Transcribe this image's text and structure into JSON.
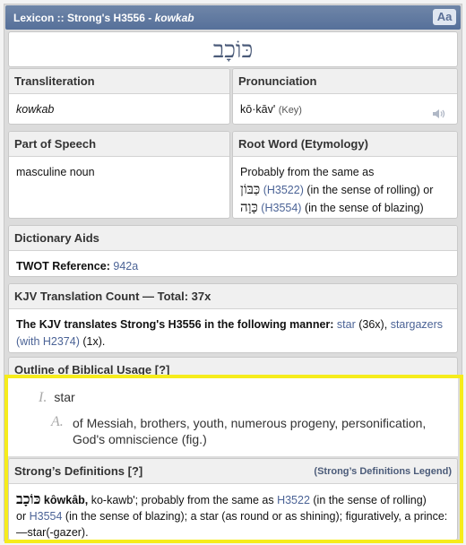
{
  "titlebar": {
    "prefix": "Lexicon :: Strong's H3556 - ",
    "word": "kowkab",
    "font_button": "Aa"
  },
  "headword": "כּוֹכָב",
  "transliteration": {
    "heading": "Transliteration",
    "value": "kowkab"
  },
  "pronunciation": {
    "heading": "Pronunciation",
    "value": "kō·kāv'",
    "key": "(Key)",
    "icon": "speaker-icon"
  },
  "part_of_speech": {
    "heading": "Part of Speech",
    "value": "masculine noun"
  },
  "root_word": {
    "heading": "Root Word (Etymology)",
    "intro": "Probably from the same as",
    "ref1_hebrew": "כַּבּוֹן",
    "ref1_code": "(H3522)",
    "ref1_sense": " (in the sense of rolling) or",
    "ref2_hebrew": "כָּוָה",
    "ref2_code": "(H3554)",
    "ref2_sense": " (in the sense of blazing)"
  },
  "dictionary_aids": {
    "heading": "Dictionary Aids",
    "label": "TWOT Reference:",
    "value": "942a"
  },
  "kjv_count": {
    "heading": "KJV Translation Count — Total: 37x",
    "lead": "The KJV translates Strong's H3556 in the following manner:",
    "item1_word": "star",
    "item1_count": " (36x),",
    "item2_word": "stargazers (with H2374)",
    "item2_count": " (1x)."
  },
  "outline": {
    "heading": "Outline of Biblical Usage [?]",
    "level1_num": "I.",
    "level1_text": "star",
    "level2_num": "A.",
    "level2_text": "of Messiah, brothers, youth, numerous progeny, personification, God's omniscience (fig.)"
  },
  "strongs_defs": {
    "heading": "Strong’s Definitions [?]",
    "legend": "(Strong’s Definitions Legend)",
    "hebrew": "כּוֹכָב",
    "translit": " kôwkâb,",
    "t1": " ko-kawb'; probably from the same as ",
    "ref1": "H3522",
    "t2": " (in the sense of rolling)",
    "t3": "or ",
    "ref2": "H3554",
    "t4": " (in the sense of blazing); a star (as round or as shining); figuratively, a prince:—star(-gazer)."
  },
  "colors": {
    "titlebar": "#5f78a0",
    "link": "#4b6396",
    "highlight": "#f6ec1b"
  }
}
